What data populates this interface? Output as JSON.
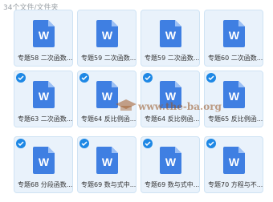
{
  "header": {
    "text": "34个文件/文件夹"
  },
  "watermark": {
    "text": "www.the-ba.org"
  },
  "colors": {
    "accent": "#1e88e5",
    "doc_blue": "#3f7fe2",
    "card_bg": "#e9f2fb"
  },
  "files": [
    {
      "label": "专题58 二次函数...",
      "checked": false,
      "icon": "word-doc-icon"
    },
    {
      "label": "专题59 二次函数...",
      "checked": false,
      "icon": "word-doc-icon"
    },
    {
      "label": "专题59 二次函数...",
      "checked": false,
      "icon": "word-doc-icon"
    },
    {
      "label": "专题60 二次函数...",
      "checked": false,
      "icon": "word-doc-icon"
    },
    {
      "label": "专题63 二次函数...",
      "checked": true,
      "icon": "word-doc-icon"
    },
    {
      "label": "专题64 反比例函...",
      "checked": true,
      "icon": "word-doc-icon"
    },
    {
      "label": "专题64 反比例函...",
      "checked": true,
      "icon": "word-doc-icon"
    },
    {
      "label": "专题65 反比例函...",
      "checked": true,
      "icon": "word-doc-icon"
    },
    {
      "label": "专题68 分段函数...",
      "checked": true,
      "icon": "word-doc-icon"
    },
    {
      "label": "专题69 数与式中...",
      "checked": true,
      "icon": "word-doc-icon"
    },
    {
      "label": "专题69 数与式中...",
      "checked": true,
      "icon": "word-doc-icon"
    },
    {
      "label": "专题70 方程与不...",
      "checked": true,
      "icon": "word-doc-icon"
    }
  ]
}
